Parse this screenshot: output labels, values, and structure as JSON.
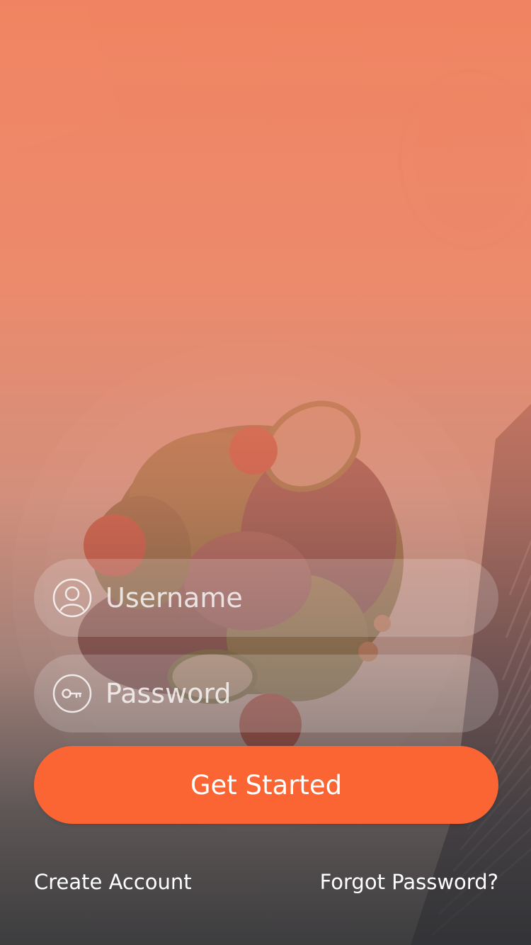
{
  "login": {
    "username": {
      "placeholder": "Username",
      "icon": "user-icon"
    },
    "password": {
      "placeholder": "Password",
      "icon": "key-icon"
    },
    "submit_label": "Get Started"
  },
  "footer": {
    "create_account_label": "Create Account",
    "forgot_password_label": "Forgot Password?"
  },
  "colors": {
    "accent": "#fb6534",
    "overlay_top": "#f0805c",
    "overlay_bottom": "#323234",
    "text": "#ffffff"
  }
}
